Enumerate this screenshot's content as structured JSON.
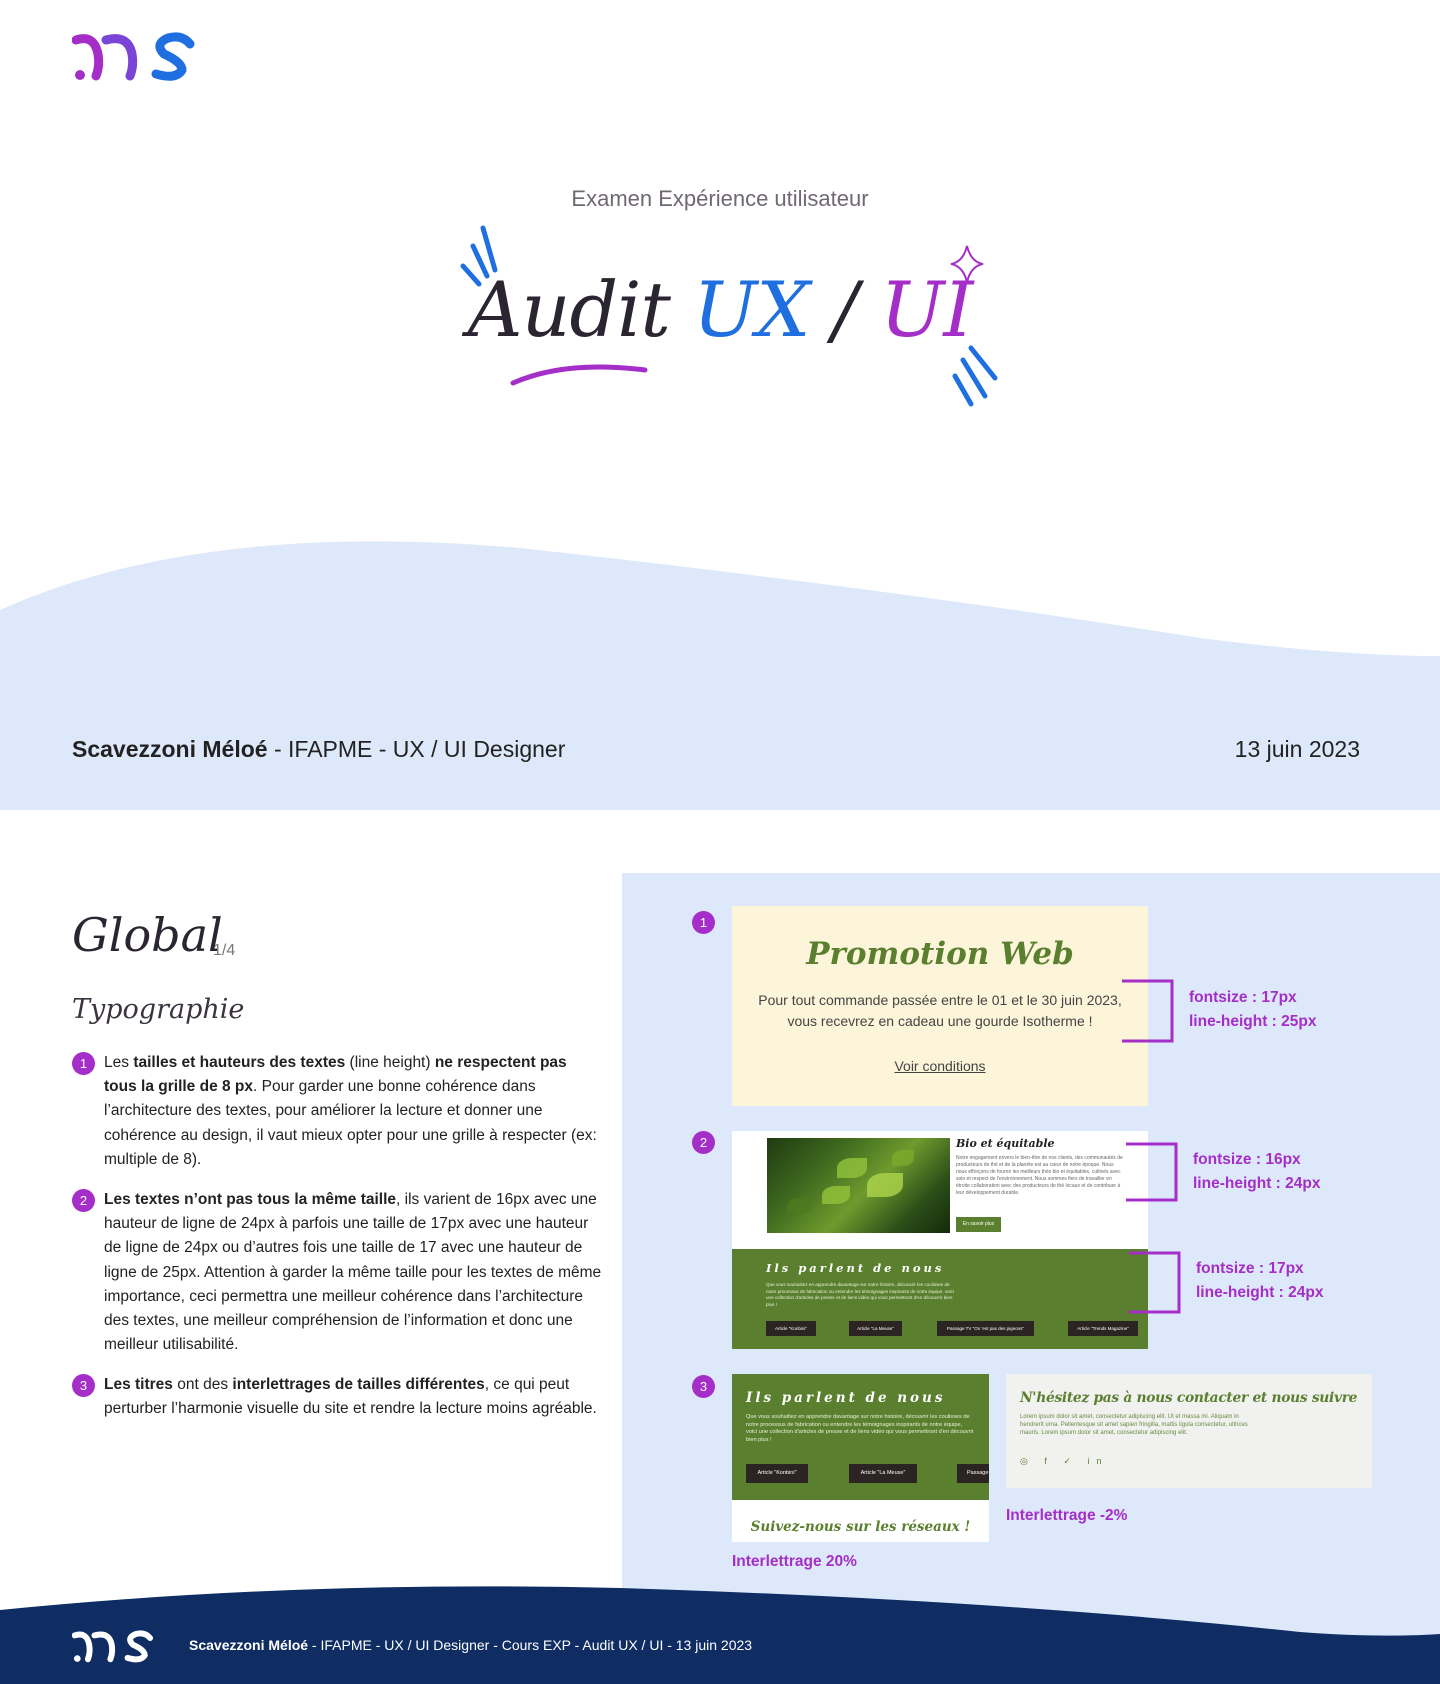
{
  "cover": {
    "subtitle": "Examen Expérience utilisateur",
    "title_audit": "Audit",
    "title_ux": "UX",
    "title_slash": "/",
    "title_ui": "UI",
    "author_name": "Scavezzoni Méloé",
    "author_role": " - IFAPME - UX / UI Designer",
    "date": "13 juin 2023"
  },
  "slide": {
    "title": "Global",
    "page": "1/4",
    "section": "Typographie",
    "points": [
      {
        "number": "1",
        "t1": "Les ",
        "b1": "tailles et hauteurs des textes",
        "t2": " (line height) ",
        "b2": "ne respectent pas tous la grille de 8 px",
        "t3": ". Pour garder une bonne cohérence dans l’architecture des textes, pour améliorer la lecture et donner une cohérence au design, il vaut mieux opter pour une grille à respecter (ex: multiple de 8)."
      },
      {
        "number": "2",
        "b1": "Les textes n’ont pas tous la même taille",
        "t1": ", ils varient de 16px avec une hauteur de ligne de 24px à parfois une taille de 17px avec une hauteur de ligne de 24px ou d’autres fois une taille de 17 avec une hauteur de ligne de 25px. Attention à garder la même taille pour les textes de même importance, ceci permettra une meilleur cohérence dans l’architecture des textes, une meilleur compréhension de l’information et donc une meilleur utilisabilité."
      },
      {
        "number": "3",
        "b1": "Les titres",
        "t1": " ont des ",
        "b2": "interlettrages de tailles différentes",
        "t2": ", ce qui peut perturber l’harmonie visuelle du site et rendre la lecture moins agréable."
      }
    ]
  },
  "examples": {
    "ex1": {
      "number": "1",
      "title": "Promotion Web",
      "text": "Pour tout commande passée entre le 01 et le 30 juin 2023, vous recevrez en cadeau une gourde Isotherme !",
      "link": "Voir conditions",
      "annot_size": "fontsize : 17px",
      "annot_lh": "line-height : 25px"
    },
    "ex2": {
      "number": "2",
      "card_title": "Bio et équitable",
      "card_text": "Notre engagement envers le bien-être de nos clients, des communautés de producteurs de thé et de la planète est au cœur de notre époque. Nous nous efforçons de fournir les meilleurs thés bio et équitables, cultivés avec soin et respect de l'environnement. Nous sommes fiers de travailler en étroite collaboration avec des producteurs de thé locaux et de contribuer à leur développement durable.",
      "card_button": "En savoir plus",
      "annot1_size": "fontsize : 16px",
      "annot1_lh": "line-height : 24px",
      "press_title": "Ils parlent de nous",
      "press_text": "Que vous souhaitiez en apprendre davantage sur notre histoire, découvrir les coulisses de notre processus de fabrication ou entendre les témoignages inspirants de notre équipe, voici une collection d'articles de presse et de liens vidéo qui vous permettront d'en découvrir bien plus !",
      "press_buttons": [
        "Article \"Konbini\"",
        "Article \"La Meuse\"",
        "Passage TV \"On 'est pas des pigeons\"",
        "Article \"Trends Magazine\""
      ],
      "annot2_size": "fontsize : 17px",
      "annot2_lh": "line-height : 24px"
    },
    "ex3": {
      "number": "3",
      "press_title": "Ils parlent de nous",
      "press_text": "Que vous souhaitiez en apprendre davantage sur notre histoire, découvrir les coulisses de notre processus de fabrication ou entendre les témoignages inspirants de notre équipe, voici une collection d'articles de presse et de liens vidéo qui vous permettront d'en découvrir bien plus !",
      "press_buttons": [
        "Article \"Konbini\"",
        "Article \"La Meuse\"",
        "Passage"
      ],
      "follow_title": "Suivez-nous sur les réseaux !",
      "annot_left": "Interlettrage 20%",
      "contact_title": "N'hésitez pas à nous contacter et nous suivre",
      "contact_text": "Lorem ipsum dolor sit amet, consectetur adipiscing elit. Ut et massa mi. Aliquam in hendrerit urna. Pellentesque sit amet sapien fringilla, mattis ligula consectetur, ultrices mauris. Lorem ipsum dolor sit amet, consectetur adipiscing elit.",
      "social_icons": [
        "instagram-icon",
        "facebook-icon",
        "twitter-icon",
        "linkedin-icon"
      ],
      "social_glyphs": "◎ f ✓ in",
      "annot_right": "Interlettrage -2%"
    }
  },
  "footer": {
    "name": "Scavezzoni Méloé",
    "rest": " - IFAPME - UX / UI Designer - Cours EXP - Audit UX / UI - 13 juin 2023"
  },
  "colors": {
    "accent_purple": "#a42ec7",
    "accent_blue": "#1f6fe0",
    "light_blue_bg": "#dde8fa",
    "navy": "#0f2d63",
    "tea_green": "#5a7f2e",
    "cream": "#fcf5da"
  }
}
